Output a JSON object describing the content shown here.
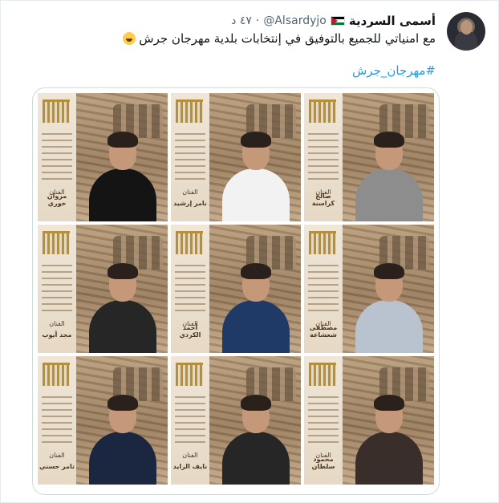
{
  "tweet": {
    "author_name": "أسمى السردية",
    "handle": "@Alsardyjo",
    "time": "٤٧ د",
    "text": "مع امنياتي للجميع بالتوفيق في إنتخابات بلدية مهرجان جرش",
    "hashtag": "#مهرجان_جرش",
    "flag_icon": "jordan-flag-icon",
    "emoji_icon": "grinning-sweat-emoji-icon"
  },
  "media": {
    "artist_label": "الفنان",
    "posters": [
      {
        "artist": "مروان خوري",
        "body_color": "#141414"
      },
      {
        "artist": "نامر إرشيد",
        "body_color": "#f2f2f2"
      },
      {
        "artist": "صالح كراسنة",
        "body_color": "#8d8d8d"
      },
      {
        "artist": "مجد أيوب",
        "body_color": "#262626"
      },
      {
        "artist": "أحمد الكردي",
        "body_color": "#1f3a66"
      },
      {
        "artist": "مصطفى شعشاعة",
        "body_color": "#b9c3cf"
      },
      {
        "artist": "تامر حسني",
        "body_color": "#1b2740"
      },
      {
        "artist": "نايف الزايد",
        "body_color": "#262626"
      },
      {
        "artist": "محمود سلطان",
        "body_color": "#3a2e2a"
      }
    ]
  }
}
